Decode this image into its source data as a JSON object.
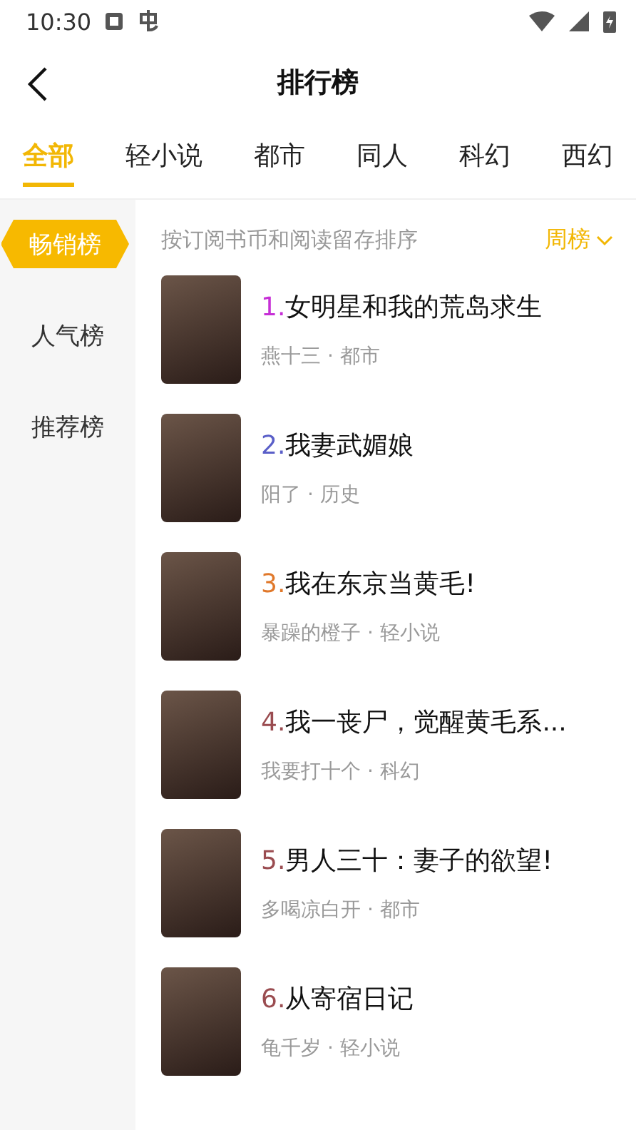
{
  "status_bar": {
    "time": "10:30"
  },
  "header": {
    "title": "排行榜"
  },
  "tabs": [
    {
      "label": "全部",
      "selected": true
    },
    {
      "label": "轻小说",
      "selected": false
    },
    {
      "label": "都市",
      "selected": false
    },
    {
      "label": "同人",
      "selected": false
    },
    {
      "label": "科幻",
      "selected": false
    },
    {
      "label": "西幻",
      "selected": false
    }
  ],
  "sidebar": [
    {
      "label": "畅销榜",
      "selected": true
    },
    {
      "label": "人气榜",
      "selected": false
    },
    {
      "label": "推荐榜",
      "selected": false
    }
  ],
  "sort_hint": "按订阅书币和阅读留存排序",
  "period": {
    "label": "周榜"
  },
  "books": [
    {
      "rank": "1.",
      "title": "女明星和我的荒岛求生",
      "meta": "燕十三 · 都市",
      "color": "#c62fd6"
    },
    {
      "rank": "2.",
      "title": "我妻武媚娘",
      "meta": "阳了 · 历史",
      "color": "#5a5fc8"
    },
    {
      "rank": "3.",
      "title": "我在东京当黄毛!",
      "meta": "暴躁的橙子 · 轻小说",
      "color": "#e0782a"
    },
    {
      "rank": "4.",
      "title": "我一丧尸，觉醒黄毛系...",
      "meta": "我要打十个 · 科幻",
      "color": "#9a4c50"
    },
    {
      "rank": "5.",
      "title": "男人三十：妻子的欲望!",
      "meta": "多喝凉白开 · 都市",
      "color": "#9a4c50"
    },
    {
      "rank": "6.",
      "title": "从寄宿日记",
      "meta": "龟千岁 · 轻小说",
      "color": "#9a4c50"
    }
  ]
}
